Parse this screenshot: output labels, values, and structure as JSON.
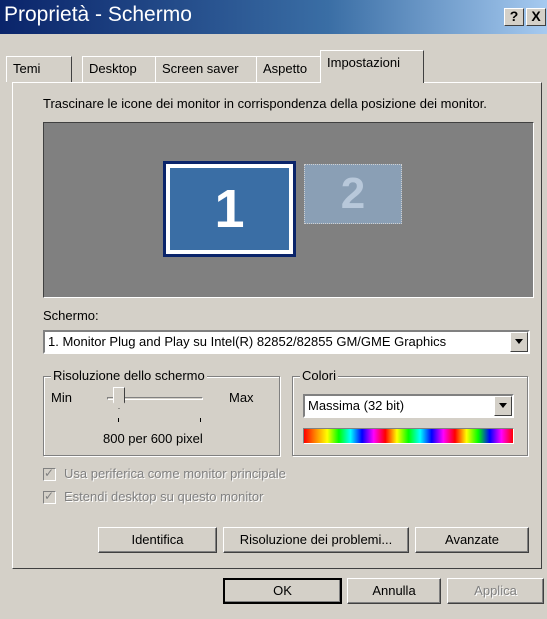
{
  "window": {
    "title": "Proprietà - Schermo",
    "help_label": "?",
    "close_label": "X"
  },
  "tabs": [
    {
      "label": "Temi"
    },
    {
      "label": "Desktop"
    },
    {
      "label": "Screen saver"
    },
    {
      "label": "Aspetto"
    },
    {
      "label": "Impostazioni"
    }
  ],
  "instructions": "Trascinare le icone dei monitor in corrispondenza della posizione dei monitor.",
  "monitors": [
    {
      "number": "1"
    },
    {
      "number": "2"
    }
  ],
  "display": {
    "label": "Schermo:",
    "value": "1. Monitor Plug and Play su Intel(R) 82852/82855 GM/GME Graphics"
  },
  "resolution": {
    "group_label": "Risoluzione dello schermo",
    "min_label": "Min",
    "max_label": "Max",
    "value_text": "800 per 600 pixel"
  },
  "colors": {
    "group_label": "Colori",
    "value": "Massima (32 bit)"
  },
  "checkboxes": [
    {
      "label": "Usa periferica come monitor principale",
      "checked": true
    },
    {
      "label": "Estendi desktop su questo monitor",
      "checked": true
    }
  ],
  "buttons": {
    "identify": "Identifica",
    "troubleshoot": "Risoluzione dei problemi...",
    "advanced": "Avanzate",
    "ok": "OK",
    "cancel": "Annulla",
    "apply": "Applica"
  }
}
